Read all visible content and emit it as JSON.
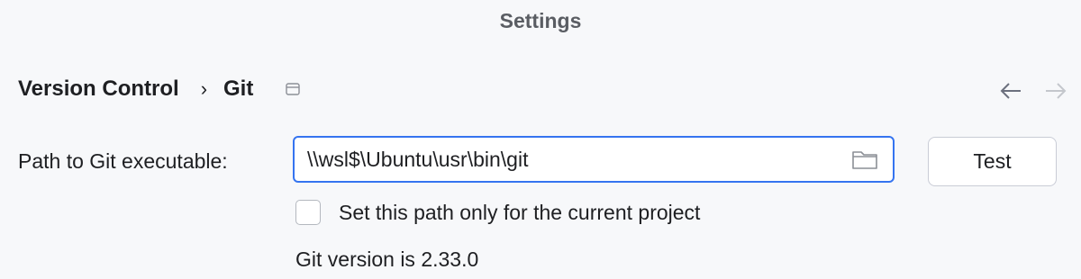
{
  "window": {
    "title": "Settings"
  },
  "breadcrumb": {
    "items": [
      "Version Control",
      "Git"
    ],
    "separator": "›"
  },
  "git_settings": {
    "path_label": "Path to Git executable:",
    "path_value": "\\\\wsl$\\Ubuntu\\usr\\bin\\git",
    "test_button": "Test",
    "project_only_checkbox": {
      "label": "Set this path only for the current project",
      "checked": false
    },
    "version_text": "Git version is 2.33.0"
  },
  "icons": {
    "project_scope": "window-icon",
    "browse": "folder-icon",
    "back": "arrow-left-icon",
    "forward": "arrow-right-icon"
  },
  "colors": {
    "accent": "#3574f0",
    "background": "#f7f8fa"
  }
}
